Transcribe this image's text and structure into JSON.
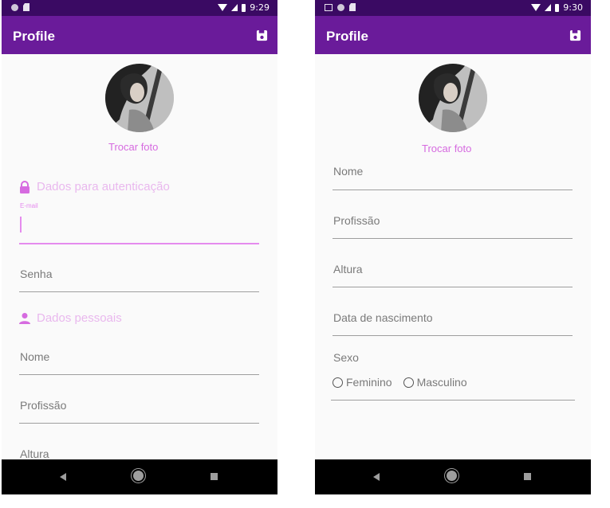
{
  "left": {
    "status_time": "9:29",
    "appbar_title": "Profile",
    "change_photo": "Trocar foto",
    "auth_section": "Dados para autenticação",
    "email_label": "E-mail",
    "password_placeholder": "Senha",
    "personal_section": "Dados pessoais",
    "name_placeholder": "Nome",
    "profession_placeholder": "Profissão",
    "height_placeholder": "Altura"
  },
  "right": {
    "status_time": "9:30",
    "appbar_title": "Profile",
    "change_photo": "Trocar foto",
    "name_placeholder": "Nome",
    "profession_placeholder": "Profissão",
    "height_placeholder": "Altura",
    "birth_placeholder": "Data de nascimento",
    "sex_label": "Sexo",
    "sex_options": [
      "Feminino",
      "Masculino"
    ]
  },
  "colors": {
    "status_bar": "#3a0a63",
    "app_bar": "#6a1b9a",
    "accent": "#d66be0",
    "section_text": "#e9b8ee"
  }
}
